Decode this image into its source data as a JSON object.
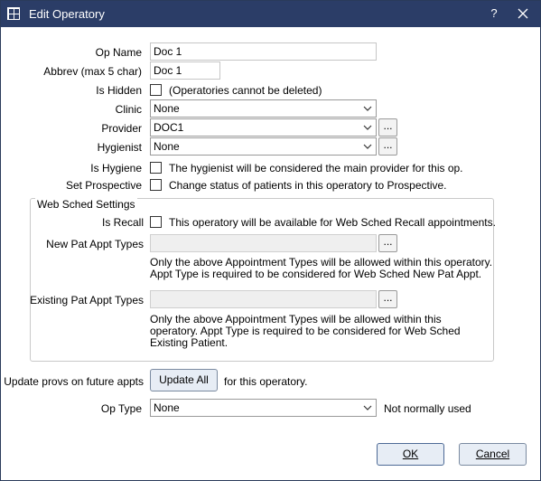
{
  "window": {
    "title": "Edit Operatory",
    "help_label": "?"
  },
  "form": {
    "op_name": {
      "label": "Op Name",
      "value": "Doc 1"
    },
    "abbrev": {
      "label": "Abbrev (max 5 char)",
      "value": "Doc 1"
    },
    "is_hidden": {
      "label": "Is Hidden",
      "checked": false,
      "note": "(Operatories cannot be deleted)"
    },
    "clinic": {
      "label": "Clinic",
      "value": "None"
    },
    "provider": {
      "label": "Provider",
      "value": "DOC1"
    },
    "hygienist": {
      "label": "Hygienist",
      "value": "None"
    },
    "is_hygiene": {
      "label": "Is Hygiene",
      "checked": false,
      "note": "The hygienist will be considered the main provider for this op."
    },
    "set_prospective": {
      "label": "Set Prospective",
      "checked": false,
      "note": "Change status of patients in this operatory to Prospective."
    },
    "ellipsis_label": "..."
  },
  "web_sched": {
    "title": "Web Sched Settings",
    "is_recall": {
      "label": "Is Recall",
      "checked": false,
      "note": "This operatory will be available for Web Sched Recall appointments."
    },
    "new_pat": {
      "label": "New Pat Appt Types",
      "value": "",
      "note_line1": "Only the above Appointment Types will be allowed within this operatory.",
      "note_line2": "Appt Type is required to be considered for Web Sched New Pat Appt."
    },
    "existing_pat": {
      "label": "Existing Pat Appt Types",
      "value": "",
      "note_line1": "Only the above Appointment Types will be allowed within this",
      "note_line2": "operatory. Appt Type is required to be considered for Web Sched",
      "note_line3": "Existing Patient."
    }
  },
  "update_provs": {
    "label": "Update provs on future appts",
    "button": "Update All",
    "suffix": "for this operatory."
  },
  "op_type": {
    "label": "Op Type",
    "value": "None",
    "note": "Not normally used"
  },
  "buttons": {
    "ok": "OK",
    "cancel": "Cancel"
  },
  "colors": {
    "titlebar": "#2b3d67",
    "button_bg": "#e7edf5"
  }
}
